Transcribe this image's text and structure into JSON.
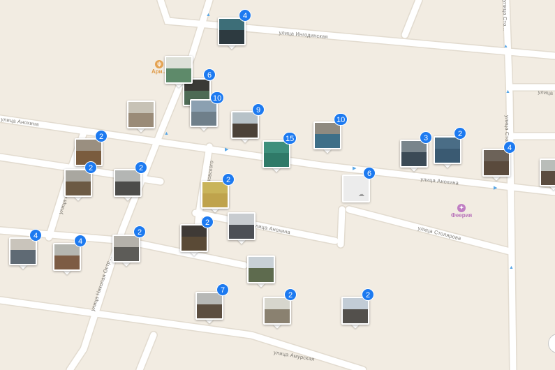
{
  "colors": {
    "background": "#f2ece2",
    "road": "#ffffff",
    "road_casing": "#e2dbcf",
    "badge": "#1d7af0",
    "poi_orange": "#e09b48",
    "poi_purple": "#b772b9",
    "oneway_arrow": "#58a6e6"
  },
  "streets": {
    "ingodinskaya": "улица Ингодинская",
    "anokhina_left": "улица Анохина",
    "anokhina_right": "улица Анохина",
    "anokhina_center": "улица Анохина",
    "stolyarova_center": "улица Столярова",
    "stolyarova_vertical": "улица Столярова",
    "stolyarova_top": "улица Сто...",
    "ostrovskogo": "улица Островского",
    "nikolaya_ostr": "улица Николая Остр...",
    "amurskaya": "улица Амурская",
    "an_left": "улица Ан...",
    "right_edge": "улица"
  },
  "pois": [
    {
      "name": "Ари...",
      "icon": "restaurant-icon"
    },
    {
      "name": "Феерия",
      "icon": "entertainment-icon"
    }
  ],
  "photo_markers": [
    {
      "count": "4",
      "icon": "house-photo"
    },
    {
      "count": "6",
      "icon": "house-photo"
    },
    {
      "count": "10",
      "icon": "house-photo"
    },
    {
      "count": "",
      "icon": "building-photo"
    },
    {
      "count": "9",
      "icon": "house-photo"
    },
    {
      "count": "15",
      "icon": "fence-photo"
    },
    {
      "count": "10",
      "icon": "house-photo"
    },
    {
      "count": "3",
      "icon": "house-photo"
    },
    {
      "count": "2",
      "icon": "house-photo"
    },
    {
      "count": "4",
      "icon": "house-photo"
    },
    {
      "count": "2",
      "icon": "house-photo"
    },
    {
      "count": "2",
      "icon": "house-photo"
    },
    {
      "count": "2",
      "icon": "house-photo"
    },
    {
      "count": "2",
      "icon": "house-photo"
    },
    {
      "count": "2",
      "icon": "house-photo"
    },
    {
      "count": "",
      "icon": "house-photo"
    },
    {
      "count": "4",
      "icon": "building-photo"
    },
    {
      "count": "4",
      "icon": "house-photo"
    },
    {
      "count": "2",
      "icon": "house-photo"
    },
    {
      "count": "",
      "icon": "tree-photo"
    },
    {
      "count": "7",
      "icon": "house-photo"
    },
    {
      "count": "2",
      "icon": "house-photo"
    },
    {
      "count": "2",
      "icon": "house-photo"
    },
    {
      "count": "",
      "icon": "house-photo"
    },
    {
      "count": "",
      "icon": "building-photo"
    }
  ],
  "empty_marker": {
    "count": "6",
    "icon": "cloud-icon"
  }
}
